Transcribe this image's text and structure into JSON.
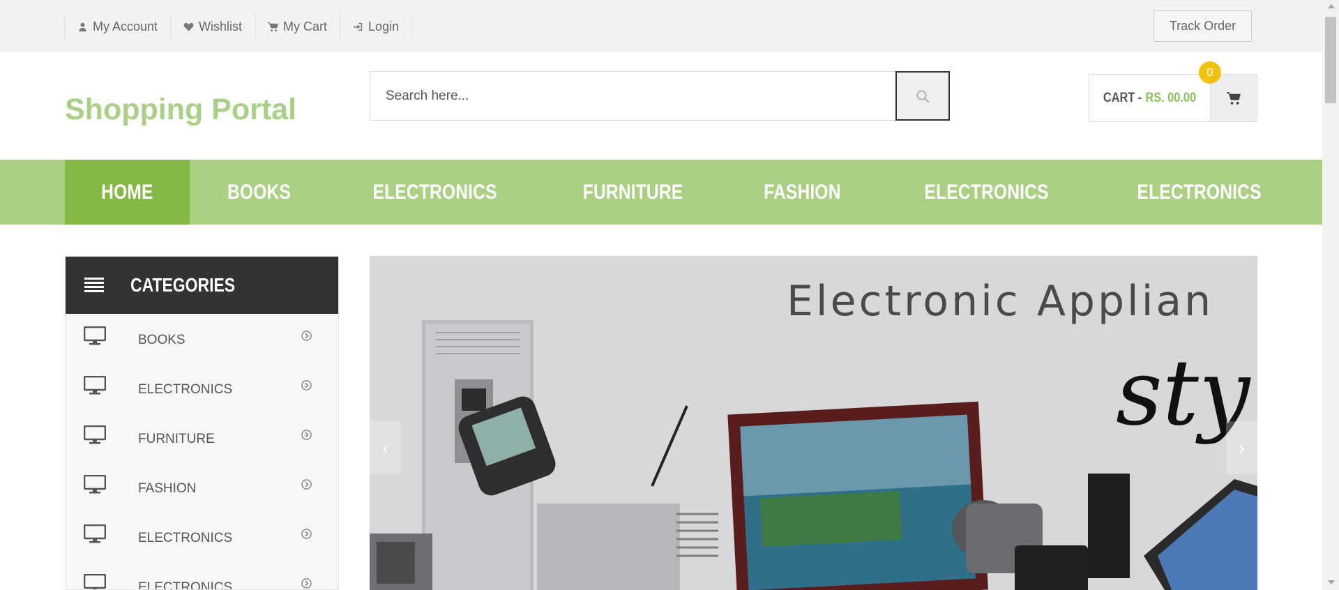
{
  "top_bar": {
    "links": [
      {
        "label": "My Account",
        "icon": "user-icon"
      },
      {
        "label": "Wishlist",
        "icon": "heart-icon"
      },
      {
        "label": "My Cart",
        "icon": "cart-icon"
      },
      {
        "label": "Login",
        "icon": "login-icon"
      }
    ],
    "track_order": "Track Order"
  },
  "header": {
    "logo": "Shopping Portal",
    "search": {
      "placeholder": "Search here...",
      "value": "",
      "button_icon": "search-icon"
    },
    "cart": {
      "label": "CART -",
      "amount": "RS. 00.00",
      "count": "0",
      "icon": "shopping-cart-icon"
    }
  },
  "nav": {
    "items": [
      {
        "label": "HOME",
        "active": true
      },
      {
        "label": "BOOKS",
        "active": false
      },
      {
        "label": "ELECTRONICS",
        "active": false
      },
      {
        "label": "FURNITURE",
        "active": false
      },
      {
        "label": "FASHION",
        "active": false
      },
      {
        "label": "ELECTRONICS",
        "active": false
      },
      {
        "label": "ELECTRONICS",
        "active": false
      }
    ]
  },
  "sidebar": {
    "title": "CATEGORIES",
    "items": [
      {
        "label": "BOOKS"
      },
      {
        "label": "ELECTRONICS"
      },
      {
        "label": "FURNITURE"
      },
      {
        "label": "FASHION"
      },
      {
        "label": "ELECTRONICS"
      },
      {
        "label": "ELECTRONICS"
      }
    ]
  },
  "banner": {
    "headline": "Electronic Applian",
    "script_text": "sty",
    "prev": "‹",
    "next": "›"
  },
  "colors": {
    "accent": "#abd084",
    "accent_dark": "#84b847",
    "logo": "#a9d086",
    "badge": "#f0c20e",
    "dark": "#333333"
  }
}
